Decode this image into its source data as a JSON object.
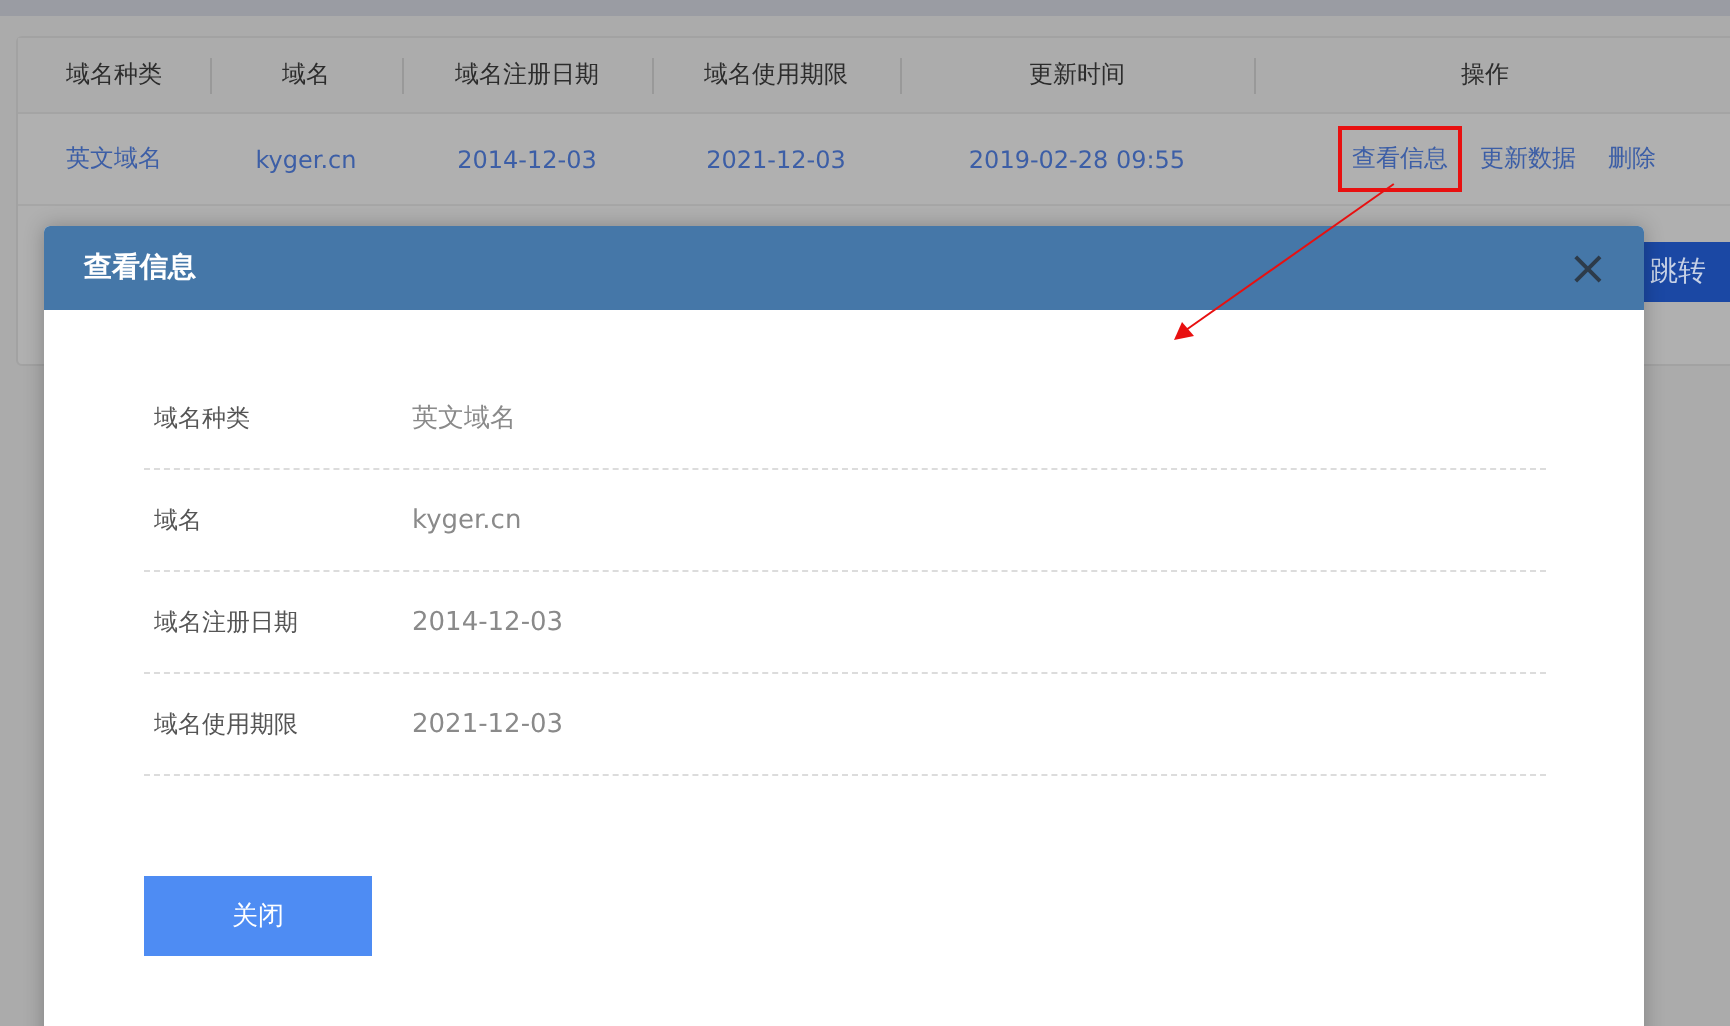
{
  "table": {
    "columns": [
      "域名种类",
      "域名",
      "域名注册日期",
      "域名使用期限",
      "更新时间",
      "操作"
    ],
    "rows": [
      {
        "cells": [
          "英文域名",
          "kyger.cn",
          "2014-12-03",
          "2021-12-03",
          "2019-02-28 09:55"
        ],
        "actions": [
          {
            "label": "查看信息",
            "highlighted": true
          },
          {
            "label": "更新数据",
            "highlighted": false
          },
          {
            "label": "删除",
            "highlighted": false
          }
        ]
      }
    ]
  },
  "jump_button": {
    "label": "跳转"
  },
  "dialog": {
    "title": "查看信息",
    "close_icon": "×",
    "fields": [
      {
        "label": "域名种类",
        "value": "英文域名"
      },
      {
        "label": "域名",
        "value": "kyger.cn"
      },
      {
        "label": "域名注册日期",
        "value": "2014-12-03"
      },
      {
        "label": "域名使用期限",
        "value": "2021-12-03"
      }
    ],
    "buttons": [
      "关闭"
    ]
  }
}
